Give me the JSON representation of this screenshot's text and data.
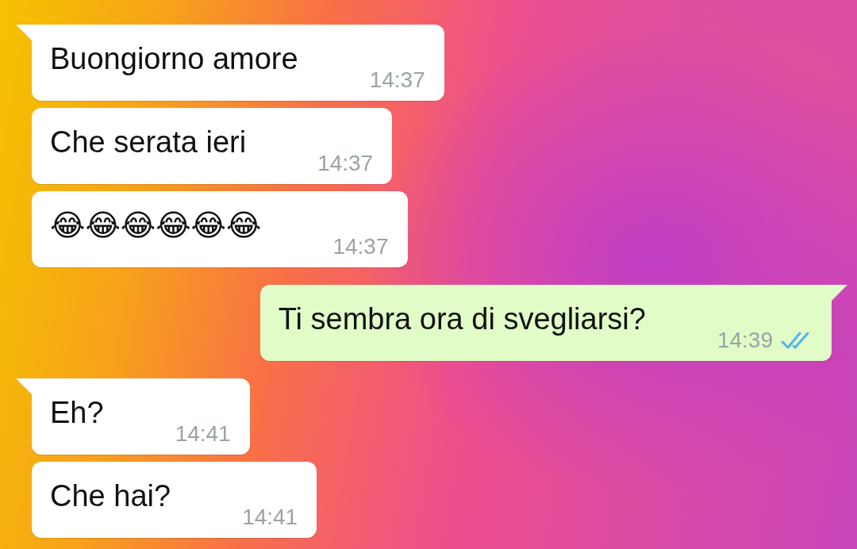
{
  "messages": [
    {
      "kind": "incoming",
      "text": "Buongiorno amore",
      "time": "14:37",
      "tail": true
    },
    {
      "kind": "incoming",
      "text": "Che serata ieri",
      "time": "14:37",
      "tail": false
    },
    {
      "kind": "incoming",
      "text": "😂😂😂😂😂😂",
      "time": "14:37",
      "tail": false
    },
    {
      "kind": "outgoing",
      "text": "Ti sembra ora di svegliarsi?",
      "time": "14:39",
      "tail": true,
      "read": true
    },
    {
      "kind": "incoming",
      "text": "Eh?",
      "time": "14:41",
      "tail": true
    },
    {
      "kind": "incoming",
      "text": "Che hai?",
      "time": "14:41",
      "tail": false
    }
  ]
}
